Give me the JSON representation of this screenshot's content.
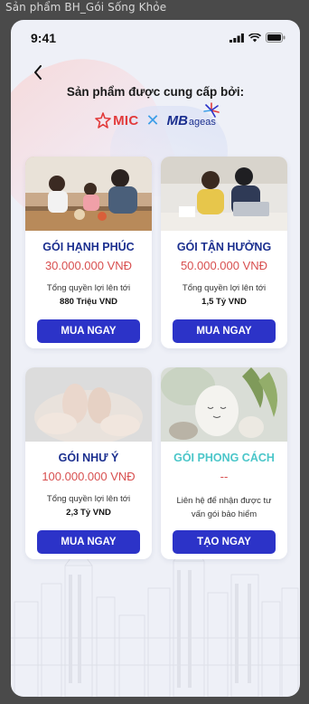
{
  "frame": {
    "title": "Sản phẩm BH_Gói Sống Khỏe"
  },
  "status_bar": {
    "time": "9:41",
    "icons": [
      "signal-icon",
      "wifi-icon",
      "battery-icon"
    ]
  },
  "header": {
    "back_icon": "chevron-left-icon",
    "provided_by": "Sản phẩm được cung cấp bởi:",
    "partner1": "MIC",
    "separator": "✕",
    "partner2_mb": "MB",
    "partner2_ageas": "ageas"
  },
  "colors": {
    "primary": "#2c33c8",
    "title_blue": "#1b2f8f",
    "price_red": "#d84f4f",
    "teal": "#4bc6c9",
    "mic_red": "#e23b3b"
  },
  "packages": [
    {
      "title": "GÓI HẠNH PHÚC",
      "price": "30.000.000 VNĐ",
      "desc": "Tổng quyền lợi lên tới",
      "amount": "880 Triệu VND",
      "button": "MUA NGAY"
    },
    {
      "title": "GÓI TẬN HƯỞNG",
      "price": "50.000.000 VNĐ",
      "desc": "Tổng quyền lợi lên tới",
      "amount": "1,5 Tỷ VND",
      "button": "MUA NGAY"
    },
    {
      "title": "GÓI NHƯ Ý",
      "price": "100.000.000 VNĐ",
      "desc": "Tổng quyền lợi lên tới",
      "amount": "2,3 Tỷ VND",
      "button": "MUA NGAY"
    },
    {
      "title": "GÓI PHONG CÁCH",
      "price": "--",
      "desc_line1": "Liên hệ để nhận được tư",
      "desc_line2": "vấn gói bảo hiểm",
      "button": "TẠO NGAY"
    }
  ]
}
